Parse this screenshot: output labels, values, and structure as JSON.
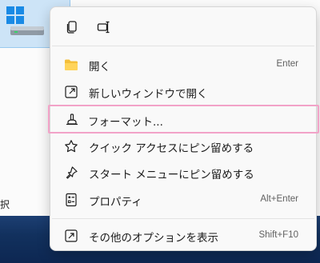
{
  "desktop": {
    "partial_label": "択"
  },
  "menu": {
    "quick_actions": [
      {
        "name": "copy-icon"
      },
      {
        "name": "rename-icon"
      }
    ],
    "items": [
      {
        "label": "開く",
        "shortcut": "Enter",
        "icon": "folder-icon"
      },
      {
        "label": "新しいウィンドウで開く",
        "shortcut": "",
        "icon": "open-new-window-icon"
      },
      {
        "label": "フォーマット...",
        "shortcut": "",
        "icon": "format-icon",
        "highlight_color": "#f2a3c8"
      },
      {
        "label": "クイック アクセスにピン留めする",
        "shortcut": "",
        "icon": "star-icon"
      },
      {
        "label": "スタート メニューにピン留めする",
        "shortcut": "",
        "icon": "pin-icon"
      },
      {
        "label": "プロパティ",
        "shortcut": "Alt+Enter",
        "icon": "properties-icon"
      },
      {
        "label": "その他のオプションを表示",
        "shortcut": "Shift+F10",
        "icon": "more-options-icon"
      }
    ]
  },
  "colors": {
    "accent": "#1a8ae5",
    "folder": "#f4bf3a",
    "highlight_border": "#f2a3c8",
    "taskbar": "#12315e"
  }
}
